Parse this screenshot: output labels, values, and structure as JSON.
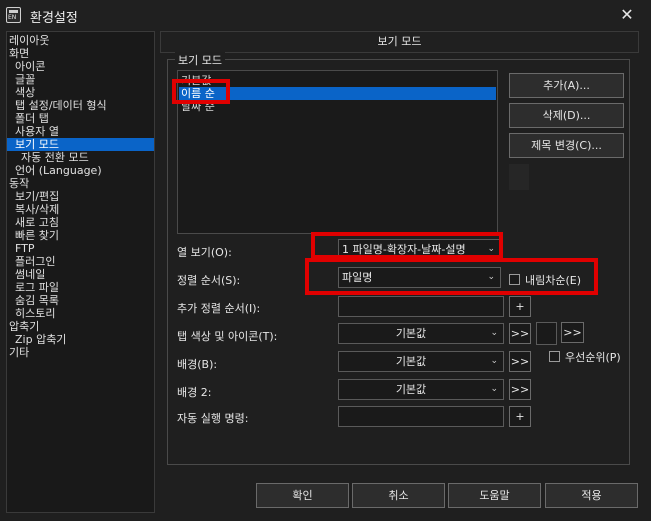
{
  "window": {
    "title": "환경설정",
    "icon_text": "EN"
  },
  "tree": [
    {
      "label": "레이아웃",
      "indent": 0,
      "selected": false
    },
    {
      "label": "화면",
      "indent": 0,
      "selected": false
    },
    {
      "label": "아이콘",
      "indent": 1,
      "selected": false
    },
    {
      "label": "글꼴",
      "indent": 1,
      "selected": false
    },
    {
      "label": "색상",
      "indent": 1,
      "selected": false
    },
    {
      "label": "탭 설정/데이터 형식",
      "indent": 1,
      "selected": false
    },
    {
      "label": "폴더 탭",
      "indent": 1,
      "selected": false
    },
    {
      "label": "사용자 열",
      "indent": 1,
      "selected": false
    },
    {
      "label": "보기 모드",
      "indent": 1,
      "selected": true
    },
    {
      "label": "자동 전환 모드",
      "indent": 2,
      "selected": false
    },
    {
      "label": "언어 (Language)",
      "indent": 1,
      "selected": false
    },
    {
      "label": "동작",
      "indent": 0,
      "selected": false
    },
    {
      "label": "보기/편집",
      "indent": 1,
      "selected": false
    },
    {
      "label": "복사/삭제",
      "indent": 1,
      "selected": false
    },
    {
      "label": "새로 고침",
      "indent": 1,
      "selected": false
    },
    {
      "label": "빠른 찾기",
      "indent": 1,
      "selected": false
    },
    {
      "label": "FTP",
      "indent": 1,
      "selected": false
    },
    {
      "label": "플러그인",
      "indent": 1,
      "selected": false
    },
    {
      "label": "썸네일",
      "indent": 1,
      "selected": false
    },
    {
      "label": "로그 파일",
      "indent": 1,
      "selected": false
    },
    {
      "label": "숨김 목록",
      "indent": 1,
      "selected": false
    },
    {
      "label": "히스토리",
      "indent": 1,
      "selected": false
    },
    {
      "label": "압축기",
      "indent": 0,
      "selected": false
    },
    {
      "label": "Zip 압축기",
      "indent": 1,
      "selected": false
    },
    {
      "label": "기타",
      "indent": 0,
      "selected": false
    }
  ],
  "panel": {
    "header": "보기 모드",
    "group_label": "보기 모드",
    "view_modes": [
      {
        "label": "기본값",
        "selected": false
      },
      {
        "label": "이름 순",
        "selected": true
      },
      {
        "label": "날짜 순",
        "selected": false
      }
    ],
    "buttons": {
      "add": "추가(A)...",
      "delete": "삭제(D)...",
      "rename": "제목 변경(C)..."
    },
    "columns": {
      "label": "열 보기(O):",
      "value": "1 파일명-확장자-날짜-설명"
    },
    "sort": {
      "label": "정렬 순서(S):",
      "value": "파일명",
      "descending_label": "내림차순(E)",
      "descending_checked": false
    },
    "extra_sort": {
      "label": "추가 정렬 순서(I):",
      "add_button": "+"
    },
    "tab_color": {
      "label": "탭 색상 및 아이콘(T):",
      "value": "기본값",
      "more_button": ">>",
      "more_button2": ">>"
    },
    "background": {
      "label": "배경(B):",
      "value": "기본값",
      "more_button": ">>",
      "priority_label": "우선순위(P)",
      "priority_checked": false
    },
    "background2": {
      "label": "배경 2:",
      "value": "기본값",
      "more_button": ">>"
    },
    "auto_run": {
      "label": "자동 실행 명령:",
      "value": "",
      "add_button": "+"
    }
  },
  "dialog_buttons": {
    "ok": "확인",
    "cancel": "취소",
    "help": "도움말",
    "apply": "적용"
  },
  "colors": {
    "highlight": "#e00000",
    "selection": "#0a64c8"
  }
}
